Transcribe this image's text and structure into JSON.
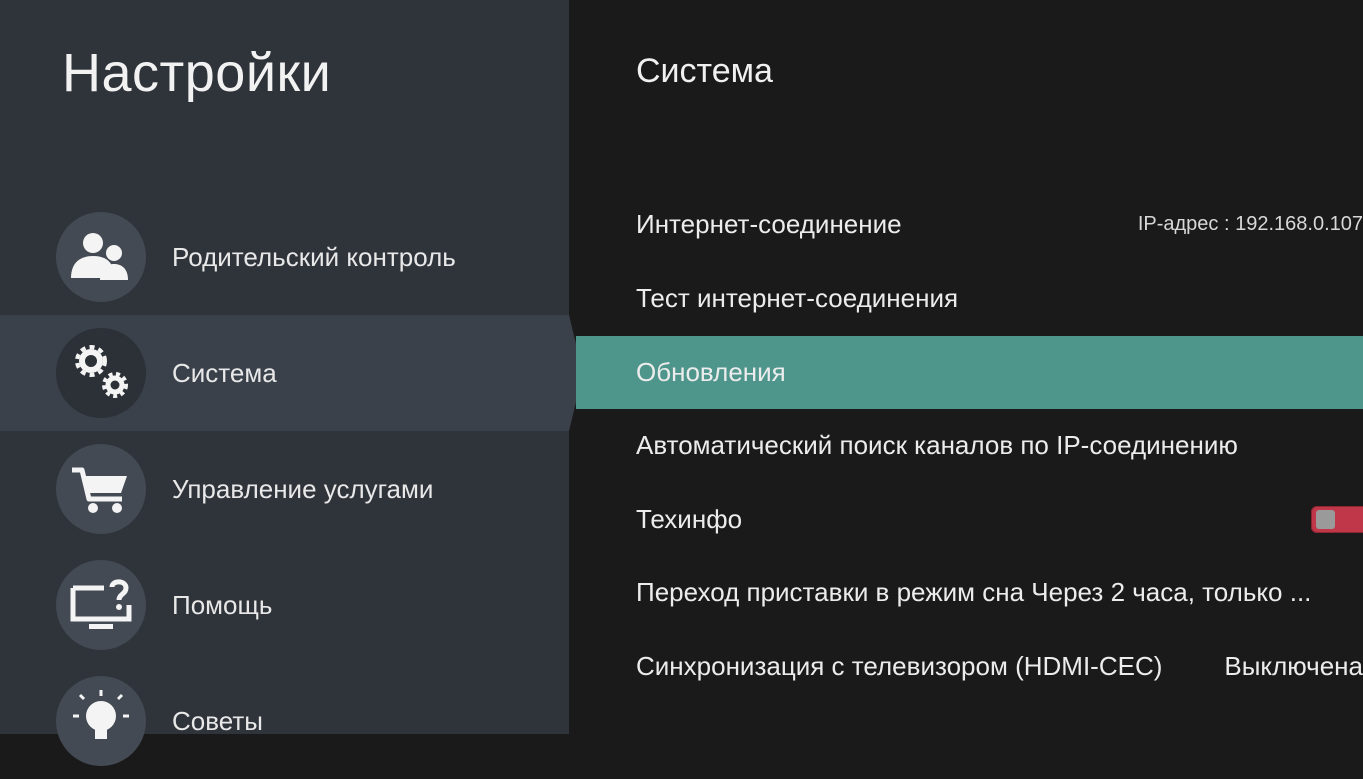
{
  "sidebar": {
    "title": "Настройки",
    "items": [
      {
        "label": "Родительский контроль",
        "icon": "parental-control-icon"
      },
      {
        "label": "Система",
        "icon": "gears-icon",
        "active": true
      },
      {
        "label": "Управление услугами",
        "icon": "cart-icon"
      },
      {
        "label": "Помощь",
        "icon": "help-monitor-icon"
      },
      {
        "label": "Советы",
        "icon": "lightbulb-icon"
      }
    ]
  },
  "content": {
    "title": "Система",
    "rows": [
      {
        "label": "Интернет-соединение",
        "value": "IP-адрес : 192.168.0.107"
      },
      {
        "label": "Тест интернет-соединения"
      },
      {
        "label": "Обновления",
        "active": true
      },
      {
        "label": "Автоматический поиск каналов по IP-соединению"
      },
      {
        "label": "Техинфо",
        "toggle": "off"
      },
      {
        "label": "Переход приставки в режим сна Через 2 часа, только ..."
      },
      {
        "label": "Синхронизация с телевизором (HDMI-CEC)",
        "value": "Выключена"
      }
    ]
  },
  "colors": {
    "sidebar_bg": "#2f333a",
    "sidebar_active": "#3a414b",
    "content_bg": "#1a1a1a",
    "highlight": "#4e968c",
    "toggle_off": "#c0374a"
  }
}
